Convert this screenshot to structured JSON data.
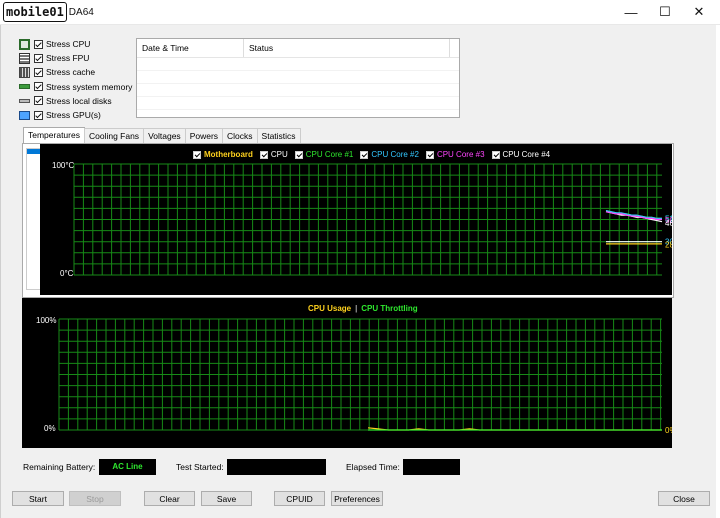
{
  "window": {
    "brand": "mobile01",
    "title": "DA64",
    "controls": {
      "minimize": "—",
      "maximize": "☐",
      "close": "✕"
    }
  },
  "stress_options": [
    {
      "label": "Stress CPU",
      "icon": "cpu-icon",
      "checked": true
    },
    {
      "label": "Stress FPU",
      "icon": "fpu-icon",
      "checked": true
    },
    {
      "label": "Stress cache",
      "icon": "cache-icon",
      "checked": true
    },
    {
      "label": "Stress system memory",
      "icon": "memory-icon",
      "checked": true
    },
    {
      "label": "Stress local disks",
      "icon": "disk-icon",
      "checked": true
    },
    {
      "label": "Stress GPU(s)",
      "icon": "monitor-icon",
      "checked": true
    }
  ],
  "log_table": {
    "columns": [
      "Date & Time",
      "Status"
    ]
  },
  "tabs": [
    {
      "label": "Temperatures",
      "active": true
    },
    {
      "label": "Cooling Fans",
      "active": false
    },
    {
      "label": "Voltages",
      "active": false
    },
    {
      "label": "Powers",
      "active": false
    },
    {
      "label": "Clocks",
      "active": false
    },
    {
      "label": "Statistics",
      "active": false
    }
  ],
  "chart_data": [
    {
      "type": "line",
      "legend": [
        {
          "name": "Motherboard",
          "color": "#ffd21e"
        },
        {
          "name": "CPU",
          "color": "#ffffff"
        },
        {
          "name": "CPU Core #1",
          "color": "#2ee82e"
        },
        {
          "name": "CPU Core #2",
          "color": "#33c8ff"
        },
        {
          "name": "CPU Core #3",
          "color": "#ff44ff"
        },
        {
          "name": "CPU Core #4",
          "color": "#ffffff"
        }
      ],
      "y_top_label": "100°C",
      "y_bottom_label": "0°C",
      "ylim": [
        0,
        100
      ],
      "grid": true,
      "grid_color": "#178a17",
      "series": [
        {
          "name": "Motherboard",
          "color": "#ffd21e",
          "values": [
            28,
            28,
            28,
            28,
            28,
            28,
            28,
            28,
            28,
            28,
            28,
            28
          ]
        },
        {
          "name": "CPU",
          "color": "#ffffff",
          "values": [
            57,
            56,
            55,
            54,
            54,
            53,
            52,
            52,
            51,
            50,
            49,
            48
          ]
        },
        {
          "name": "CPU Core #1",
          "color": "#2ee82e",
          "values": [
            58,
            57,
            56,
            55,
            55,
            54,
            53,
            53,
            52,
            52,
            51,
            51
          ]
        },
        {
          "name": "CPU Core #2",
          "color": "#33c8ff",
          "values": [
            58,
            57,
            56,
            56,
            55,
            54,
            54,
            53,
            52,
            52,
            51,
            51
          ]
        },
        {
          "name": "CPU Core #3",
          "color": "#ff44ff",
          "values": [
            57,
            56,
            55,
            55,
            54,
            53,
            53,
            52,
            51,
            51,
            50,
            50
          ]
        },
        {
          "name": "CPU Core #4",
          "color": "#ffffff",
          "values": [
            30,
            30,
            30,
            30,
            30,
            30,
            30,
            30,
            30,
            30,
            30,
            30
          ]
        }
      ],
      "value_labels": [
        {
          "text": "51",
          "value": 51,
          "color": "#2ee82e"
        },
        {
          "text": "51",
          "value": 51,
          "color": "#33c8ff"
        },
        {
          "text": "50",
          "value": 49.5,
          "color": "#ff44ff"
        },
        {
          "text": "46",
          "value": 47,
          "color": "#ffffff"
        },
        {
          "text": "30",
          "value": 30,
          "color": "#33c8ff"
        },
        {
          "text": "28",
          "value": 27.5,
          "color": "#ffd21e"
        }
      ]
    },
    {
      "type": "line",
      "legend": [
        {
          "name": "CPU Usage",
          "color": "#ffd21e"
        },
        {
          "name": "CPU Throttling",
          "color": "#2ee82e"
        }
      ],
      "legend_separator": "|",
      "y_top_label": "100%",
      "y_bottom_label": "0%",
      "ylim": [
        0,
        100
      ],
      "grid": true,
      "grid_color": "#178a17",
      "series": [
        {
          "name": "CPU Usage",
          "color": "#ffd21e",
          "values": [
            2,
            1,
            0,
            0,
            0,
            1,
            0,
            0,
            0,
            0,
            1,
            0,
            0,
            0,
            0,
            0,
            0,
            0,
            0,
            0,
            0,
            0,
            0,
            0,
            0,
            0,
            0,
            0,
            0,
            0
          ]
        },
        {
          "name": "CPU Throttling",
          "color": "#2ee82e",
          "values": [
            0,
            0,
            0,
            0,
            0,
            0,
            0,
            0,
            0,
            0,
            0,
            0,
            0,
            0,
            0,
            0,
            0,
            0,
            0,
            0,
            0,
            0,
            0,
            0,
            0,
            0,
            0,
            0,
            0,
            0
          ]
        }
      ],
      "value_labels": [
        {
          "text": "0%",
          "value": 0,
          "color": "#ffd21e"
        },
        {
          "text": "0%",
          "value": 0,
          "color": "#2ee82e"
        }
      ]
    }
  ],
  "status_bar": {
    "remaining_battery_label": "Remaining Battery:",
    "remaining_battery_value": "AC Line",
    "test_started_label": "Test Started:",
    "test_started_value": "",
    "elapsed_time_label": "Elapsed Time:",
    "elapsed_time_value": ""
  },
  "buttons": {
    "start": "Start",
    "stop": "Stop",
    "clear": "Clear",
    "save": "Save",
    "cpuid": "CPUID",
    "preferences": "Preferences",
    "close": "Close"
  }
}
